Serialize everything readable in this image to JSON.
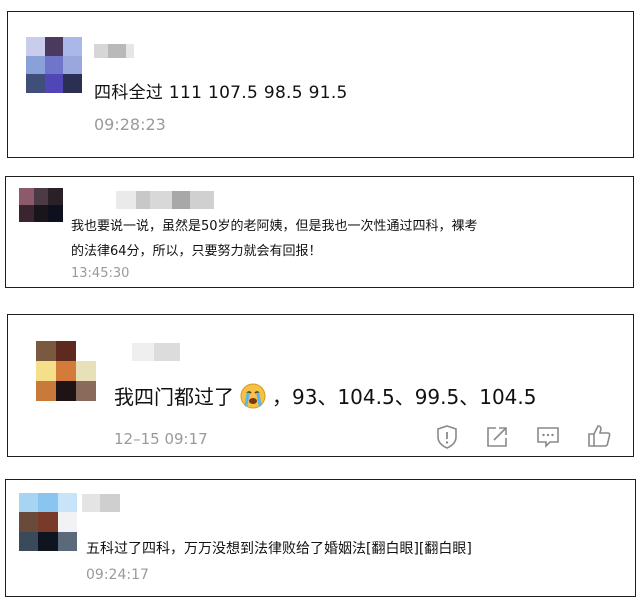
{
  "comments": [
    {
      "text_lines": [
        "四科全过  111 107.5  98.5 91.5"
      ],
      "time": "09:28:23",
      "avatar_colors": [
        "#c9cdeb",
        "#4c3a5e",
        "#a9b8e8",
        "#8aa0d8",
        "#6f76c9",
        "#9aa6de",
        "#3f4e7a",
        "#5046b8",
        "#2b2f52"
      ],
      "name_blur_colors": [
        "#d6d6d6",
        "#b9b9b9",
        "#e6e6e6"
      ]
    },
    {
      "text_lines": [
        "我也要说一说，虽然是50岁的老阿姨，但是我也一次性通过四科，裸考",
        "的法律64分，所以，只要努力就会有回报！"
      ],
      "time": "13:45:30",
      "avatar_colors": [
        "#8c5a6a",
        "#4c3a44",
        "#2a2028",
        "#3a2430",
        "#1a141c",
        "#0e1020"
      ],
      "name_blur_colors": [
        "#eaeaea",
        "#c8c8c8",
        "#d8d8d8",
        "#a8a8a8",
        "#d0d0d0"
      ]
    },
    {
      "text_parts": {
        "before_emoji": "我四门都过了",
        "after_emoji": "，93、104.5、99.5、104.5"
      },
      "time": "12–15 09:17",
      "avatar_colors": [
        "#7a5a3e",
        "#5e2a1e",
        "#ffffff",
        "#f4e08a",
        "#d47a3a",
        "#e8e0b8",
        "#c87a3a",
        "#1e1416",
        "#8a6a5a"
      ],
      "name_blur_colors": [
        "#efefef",
        "#dcdcdc"
      ],
      "actions": {
        "report": "report-icon",
        "share": "share-icon",
        "reply": "comment-icon",
        "like": "thumbs-up-icon"
      }
    },
    {
      "text_lines": [
        "五科过了四科，万万没想到法律败给了婚姻法[翻白眼][翻白眼]"
      ],
      "time": "09:24:17",
      "avatar_colors": [
        "#a8d4f4",
        "#8ac4f0",
        "#c8e4f8",
        "#6a4a3a",
        "#7a3a2a",
        "#f2f2f4",
        "#3a4a5a",
        "#0e1420",
        "#5a6a7a"
      ],
      "name_blur_colors": [
        "#e4e4e4",
        "#cfcfcf"
      ]
    }
  ],
  "colors": {
    "border": "#1e1e1e",
    "text": "#111111",
    "time": "#9a9a9a",
    "icon": "#8a8a8a"
  }
}
